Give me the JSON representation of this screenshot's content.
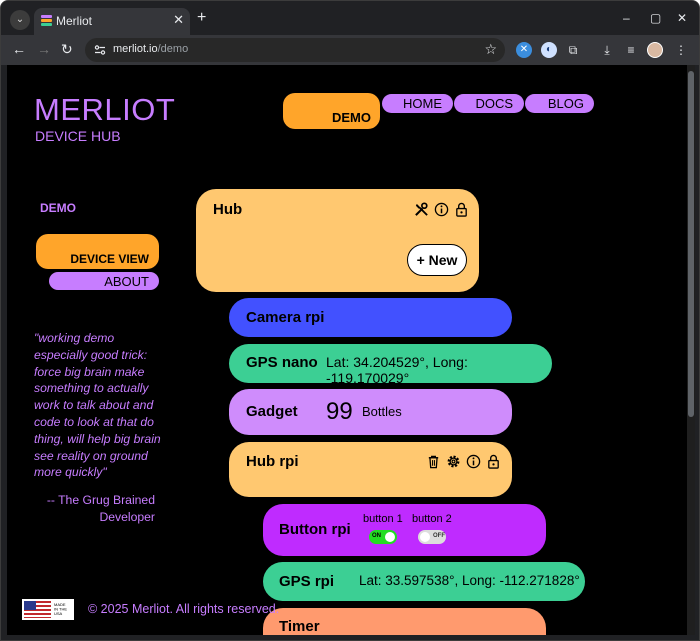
{
  "browser": {
    "tab_title": "Merliot",
    "url_host": "merliot.io",
    "url_path": "/demo"
  },
  "brand": {
    "name": "MERLIOT",
    "subtitle": "DEVICE HUB"
  },
  "topnav": {
    "demo": "DEMO",
    "home": "HOME",
    "docs": "DOCS",
    "blog": "BLOG"
  },
  "sidebar": {
    "title": "DEMO",
    "device_view": "DEVICE VIEW",
    "about": "ABOUT"
  },
  "quote": {
    "text": "\"working demo especially good trick: force big brain make something to actually work to talk about and code to look at that do thing, will help big brain see reality on ground more quickly\"",
    "author": "-- The Grug Brained Developer"
  },
  "footer": {
    "flag_text": "MADE IN THE USA",
    "copyright": "© 2025 Merliot. All rights reserved."
  },
  "devices": {
    "hub": {
      "name": "Hub",
      "new_button": "+ New"
    },
    "camera": {
      "name": "Camera rpi"
    },
    "gps_nano": {
      "name": "GPS nano",
      "location": "Lat: 34.204529°, Long: -119.170029°"
    },
    "gadget": {
      "name": "Gadget",
      "count": "99",
      "unit": "Bottles"
    },
    "hub_rpi": {
      "name": "Hub rpi"
    },
    "button_rpi": {
      "name": "Button rpi",
      "button1_label": "button 1",
      "button1_state": "ON",
      "button2_label": "button 2",
      "button2_state": "OFF"
    },
    "gps_rpi": {
      "name": "GPS rpi",
      "location": "Lat: 33.597538°, Long: -112.271828°"
    },
    "timer": {
      "name": "Timer"
    }
  },
  "colors": {
    "accent_purple": "#c77dff",
    "accent_orange": "#ffa52a",
    "hub_card": "#ffc870",
    "camera_card": "#4251ff",
    "gps_card": "#3ccf94",
    "gadget_card": "#cf8cfc",
    "button_card": "#bf2bff",
    "timer_card": "#ff9a6e"
  }
}
